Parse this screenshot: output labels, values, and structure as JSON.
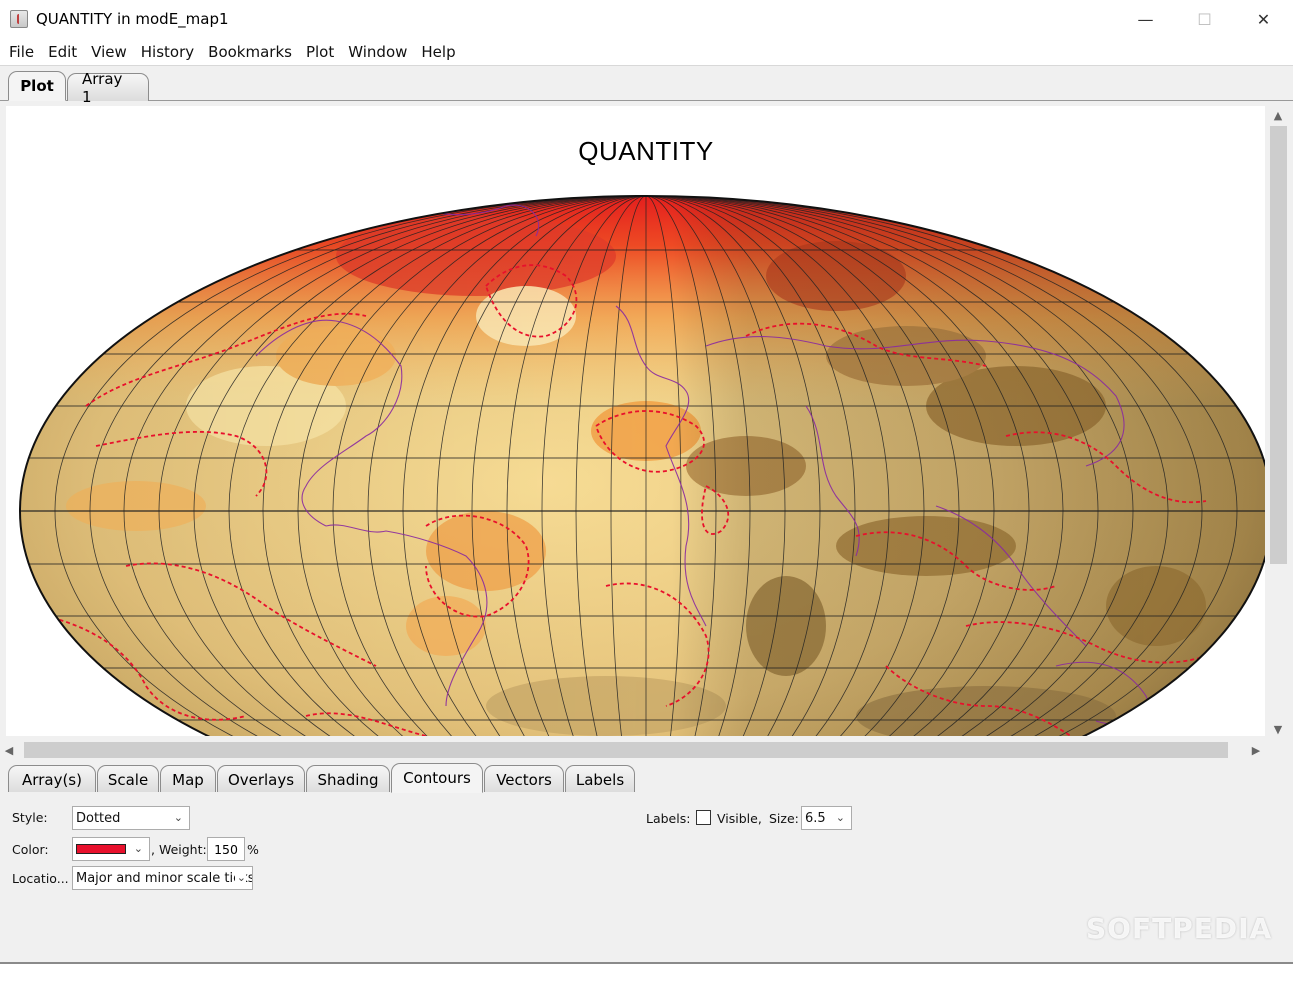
{
  "window": {
    "title": "QUANTITY in modE_map1",
    "controls": {
      "minimize": "—",
      "maximize": "☐",
      "close": "✕"
    }
  },
  "menubar": [
    "File",
    "Edit",
    "View",
    "History",
    "Bookmarks",
    "Plot",
    "Window",
    "Help"
  ],
  "top_tabs": [
    {
      "label": "Plot",
      "active": true
    },
    {
      "label": "Array 1",
      "active": false
    }
  ],
  "plot": {
    "title": "QUANTITY"
  },
  "scrollbars": {
    "up": "▲",
    "down": "▼",
    "left": "◀",
    "right": "▶"
  },
  "bottom_tabs": [
    {
      "label": "Array(s)",
      "active": false
    },
    {
      "label": "Scale",
      "active": false
    },
    {
      "label": "Map",
      "active": false
    },
    {
      "label": "Overlays",
      "active": false
    },
    {
      "label": "Shading",
      "active": false
    },
    {
      "label": "Contours",
      "active": true
    },
    {
      "label": "Vectors",
      "active": false
    },
    {
      "label": "Labels",
      "active": false
    }
  ],
  "contours": {
    "style_label": "Style:",
    "style_value": "Dotted",
    "color_label": "Color:",
    "color_value": "#e8102c",
    "weight_label": ", Weight:",
    "weight_value": "150",
    "weight_unit": "%",
    "location_label": "Locatio...",
    "location_value": "Major and minor scale ticks",
    "labels_label": "Labels:",
    "visible_label": "Visible,",
    "visible_checked": false,
    "size_label": "Size:",
    "size_value": "6.5"
  },
  "watermark": "SOFTPEDIA"
}
